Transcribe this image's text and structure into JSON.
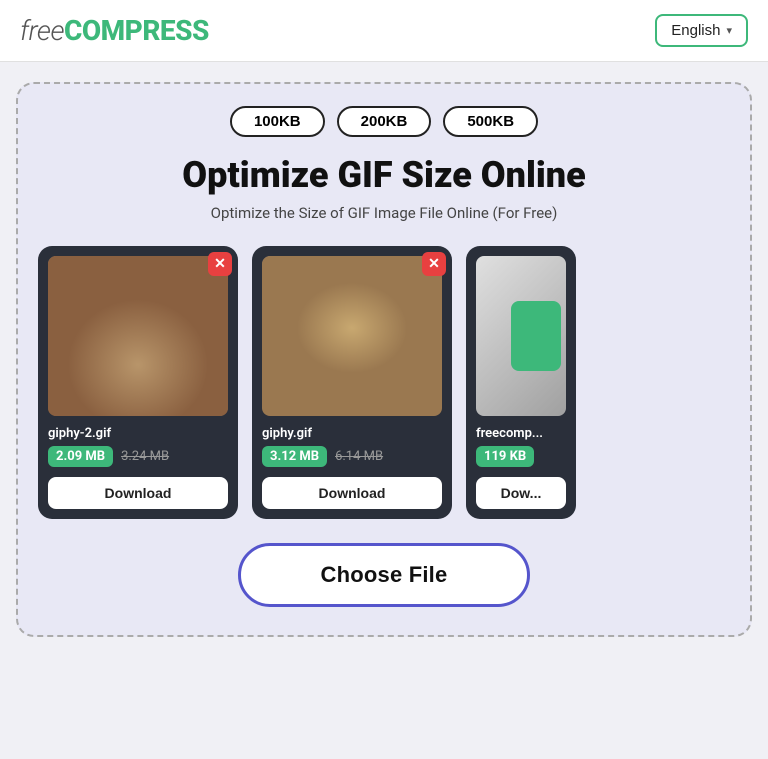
{
  "header": {
    "logo_free": "free",
    "logo_compress": "COMPRESS",
    "lang_label": "English",
    "lang_chevron": "▾"
  },
  "card": {
    "size_pills": [
      "100KB",
      "200KB",
      "500KB"
    ],
    "title": "Optimize GIF Size Online",
    "subtitle": "Optimize the Size of GIF Image File Online (For Free)",
    "files": [
      {
        "name": "giphy-2.gif",
        "size_compressed": "2.09 MB",
        "size_original": "3.24 MB",
        "download_label": "Download",
        "type": "cat1"
      },
      {
        "name": "giphy.gif",
        "size_compressed": "3.12 MB",
        "size_original": "6.14 MB",
        "download_label": "Download",
        "type": "cat2"
      },
      {
        "name": "freecomp...",
        "size_compressed": "119 KB",
        "size_original": "",
        "download_label": "Dow...",
        "type": "cat3"
      }
    ],
    "choose_file_label": "Choose File"
  }
}
